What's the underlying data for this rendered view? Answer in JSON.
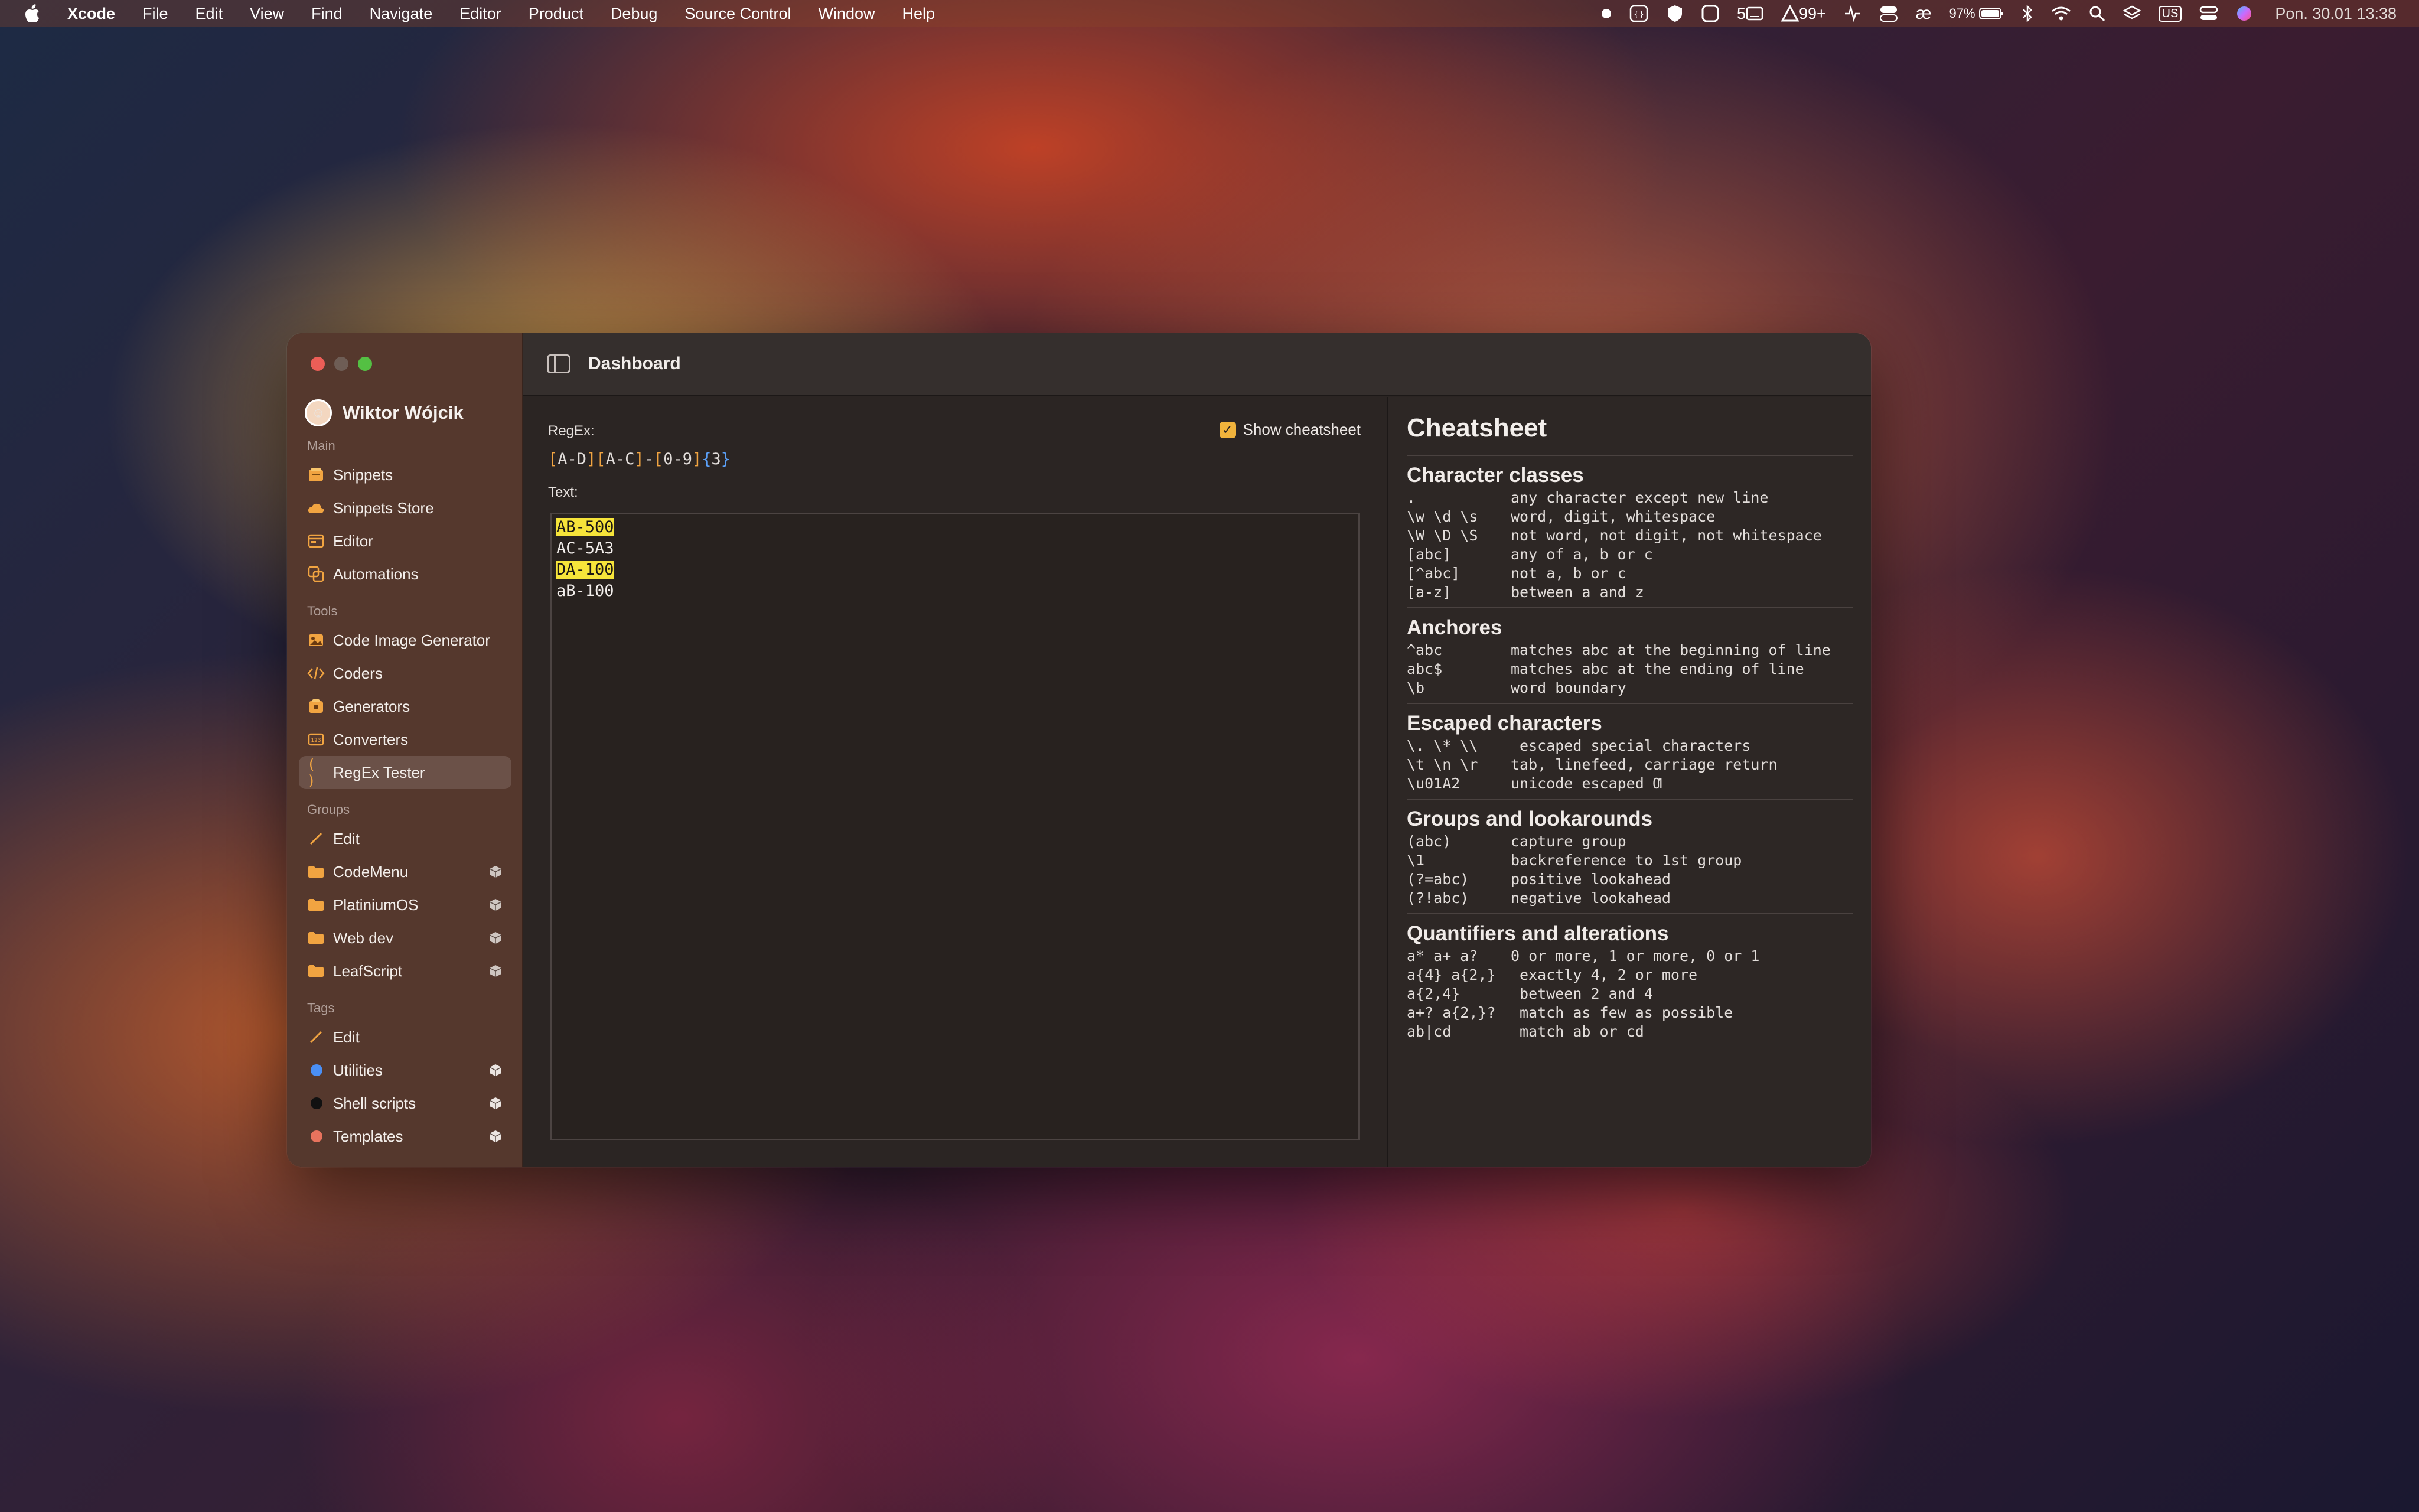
{
  "menubar": {
    "app": "Xcode",
    "menus": [
      "File",
      "Edit",
      "View",
      "Find",
      "Navigate",
      "Editor",
      "Product",
      "Debug",
      "Source Control",
      "Window",
      "Help"
    ],
    "status": {
      "notifications_count": "99+",
      "tabs_count": "5",
      "battery": "97%",
      "keyboard": "US",
      "datetime": "Pon. 30.01  13:38"
    }
  },
  "window": {
    "toolbar_title": "Dashboard",
    "user": {
      "name": "Wiktor Wójcik"
    },
    "sidebar": {
      "sections": [
        {
          "title": "Main",
          "items": [
            {
              "label": "Snippets",
              "icon": "snippets-icon"
            },
            {
              "label": "Snippets Store",
              "icon": "cloud-icon"
            },
            {
              "label": "Editor",
              "icon": "editor-icon"
            },
            {
              "label": "Automations",
              "icon": "automations-icon"
            }
          ]
        },
        {
          "title": "Tools",
          "items": [
            {
              "label": "Code Image Generator",
              "icon": "image-icon"
            },
            {
              "label": "Coders",
              "icon": "code-icon"
            },
            {
              "label": "Generators",
              "icon": "generators-icon"
            },
            {
              "label": "Converters",
              "icon": "converters-icon"
            },
            {
              "label": "RegEx Tester",
              "icon": "regex-icon",
              "active": true
            }
          ]
        },
        {
          "title": "Groups",
          "items": [
            {
              "label": "Edit",
              "icon": "pencil-icon"
            },
            {
              "label": "CodeMenu",
              "icon": "folder-icon"
            },
            {
              "label": "PlatiniumOS",
              "icon": "folder-icon"
            },
            {
              "label": "Web dev",
              "icon": "folder-icon"
            },
            {
              "label": "LeafScript",
              "icon": "folder-icon"
            }
          ]
        },
        {
          "title": "Tags",
          "items": [
            {
              "label": "Edit",
              "icon": "pencil-icon"
            },
            {
              "label": "Utilities",
              "color": "#4a8ff5"
            },
            {
              "label": "Shell scripts",
              "color": "#111111"
            },
            {
              "label": "Templates",
              "color": "#e8735d"
            }
          ]
        }
      ]
    },
    "regex": {
      "label": "RegEx:",
      "pattern": "[A-D][A-C]-[0-9]{3}",
      "show_cheatsheet_label": "Show cheatsheet",
      "show_cheatsheet": true,
      "text_label": "Text:",
      "lines": [
        {
          "text": "AB-500",
          "match": true
        },
        {
          "text": "AC-5A3",
          "match": false
        },
        {
          "text": "DA-100",
          "match": true
        },
        {
          "text": "aB-100",
          "match": false
        }
      ],
      "highlight_color": "#f6e43a"
    },
    "cheatsheet": {
      "title": "Cheatsheet",
      "sections": [
        {
          "title": "Character classes",
          "rows": [
            [
              ".",
              "any character except new line"
            ],
            [
              "\\w \\d \\s",
              "word, digit, whitespace"
            ],
            [
              "\\W \\D \\S",
              "not word, not digit, not whitespace"
            ],
            [
              "[abc]",
              "any of a, b or c"
            ],
            [
              "[^abc]",
              "not a, b or c"
            ],
            [
              "[a-z]",
              "between a and z"
            ]
          ]
        },
        {
          "title": "Anchores",
          "rows": [
            [
              "^abc",
              "matches abc at the beginning of line"
            ],
            [
              "abc$",
              "matches abc at the ending of line"
            ],
            [
              "\\b",
              "word boundary"
            ]
          ]
        },
        {
          "title": "Escaped characters",
          "rows": [
            [
              "\\. \\* \\\\",
              " escaped special characters"
            ],
            [
              "\\t \\n \\r",
              "tab, linefeed, carriage return"
            ],
            [
              "\\u01A2",
              "unicode escaped Ƣ"
            ]
          ]
        },
        {
          "title": "Groups and lookarounds",
          "rows": [
            [
              "(abc)",
              "capture group"
            ],
            [
              "\\1",
              "backreference to 1st group"
            ],
            [
              "(?=abc)",
              "positive lookahead"
            ],
            [
              "(?!abc)",
              "negative lookahead"
            ]
          ]
        },
        {
          "title": "Quantifiers and alterations",
          "rows": [
            [
              "a* a+ a?",
              "0 or more, 1 or more, 0 or 1"
            ],
            [
              "a{4} a{2,}",
              " exactly 4, 2 or more"
            ],
            [
              "a{2,4}",
              " between 2 and 4"
            ],
            [
              "a+? a{2,}?",
              " match as few as possible"
            ],
            [
              "ab|cd",
              " match ab or cd"
            ]
          ]
        }
      ]
    }
  }
}
